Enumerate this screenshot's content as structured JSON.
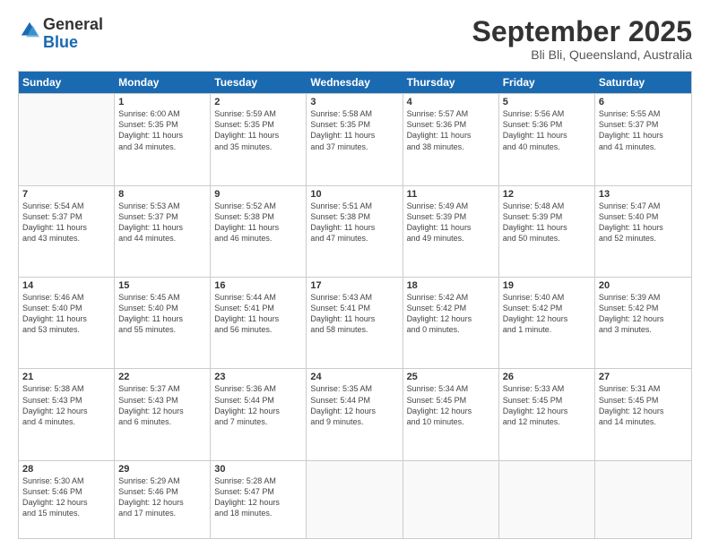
{
  "logo": {
    "general": "General",
    "blue": "Blue"
  },
  "title": "September 2025",
  "location": "Bli Bli, Queensland, Australia",
  "days": [
    "Sunday",
    "Monday",
    "Tuesday",
    "Wednesday",
    "Thursday",
    "Friday",
    "Saturday"
  ],
  "weeks": [
    [
      {
        "day": "",
        "content": ""
      },
      {
        "day": "1",
        "content": "Sunrise: 6:00 AM\nSunset: 5:35 PM\nDaylight: 11 hours\nand 34 minutes."
      },
      {
        "day": "2",
        "content": "Sunrise: 5:59 AM\nSunset: 5:35 PM\nDaylight: 11 hours\nand 35 minutes."
      },
      {
        "day": "3",
        "content": "Sunrise: 5:58 AM\nSunset: 5:35 PM\nDaylight: 11 hours\nand 37 minutes."
      },
      {
        "day": "4",
        "content": "Sunrise: 5:57 AM\nSunset: 5:36 PM\nDaylight: 11 hours\nand 38 minutes."
      },
      {
        "day": "5",
        "content": "Sunrise: 5:56 AM\nSunset: 5:36 PM\nDaylight: 11 hours\nand 40 minutes."
      },
      {
        "day": "6",
        "content": "Sunrise: 5:55 AM\nSunset: 5:37 PM\nDaylight: 11 hours\nand 41 minutes."
      }
    ],
    [
      {
        "day": "7",
        "content": "Sunrise: 5:54 AM\nSunset: 5:37 PM\nDaylight: 11 hours\nand 43 minutes."
      },
      {
        "day": "8",
        "content": "Sunrise: 5:53 AM\nSunset: 5:37 PM\nDaylight: 11 hours\nand 44 minutes."
      },
      {
        "day": "9",
        "content": "Sunrise: 5:52 AM\nSunset: 5:38 PM\nDaylight: 11 hours\nand 46 minutes."
      },
      {
        "day": "10",
        "content": "Sunrise: 5:51 AM\nSunset: 5:38 PM\nDaylight: 11 hours\nand 47 minutes."
      },
      {
        "day": "11",
        "content": "Sunrise: 5:49 AM\nSunset: 5:39 PM\nDaylight: 11 hours\nand 49 minutes."
      },
      {
        "day": "12",
        "content": "Sunrise: 5:48 AM\nSunset: 5:39 PM\nDaylight: 11 hours\nand 50 minutes."
      },
      {
        "day": "13",
        "content": "Sunrise: 5:47 AM\nSunset: 5:40 PM\nDaylight: 11 hours\nand 52 minutes."
      }
    ],
    [
      {
        "day": "14",
        "content": "Sunrise: 5:46 AM\nSunset: 5:40 PM\nDaylight: 11 hours\nand 53 minutes."
      },
      {
        "day": "15",
        "content": "Sunrise: 5:45 AM\nSunset: 5:40 PM\nDaylight: 11 hours\nand 55 minutes."
      },
      {
        "day": "16",
        "content": "Sunrise: 5:44 AM\nSunset: 5:41 PM\nDaylight: 11 hours\nand 56 minutes."
      },
      {
        "day": "17",
        "content": "Sunrise: 5:43 AM\nSunset: 5:41 PM\nDaylight: 11 hours\nand 58 minutes."
      },
      {
        "day": "18",
        "content": "Sunrise: 5:42 AM\nSunset: 5:42 PM\nDaylight: 12 hours\nand 0 minutes."
      },
      {
        "day": "19",
        "content": "Sunrise: 5:40 AM\nSunset: 5:42 PM\nDaylight: 12 hours\nand 1 minute."
      },
      {
        "day": "20",
        "content": "Sunrise: 5:39 AM\nSunset: 5:42 PM\nDaylight: 12 hours\nand 3 minutes."
      }
    ],
    [
      {
        "day": "21",
        "content": "Sunrise: 5:38 AM\nSunset: 5:43 PM\nDaylight: 12 hours\nand 4 minutes."
      },
      {
        "day": "22",
        "content": "Sunrise: 5:37 AM\nSunset: 5:43 PM\nDaylight: 12 hours\nand 6 minutes."
      },
      {
        "day": "23",
        "content": "Sunrise: 5:36 AM\nSunset: 5:44 PM\nDaylight: 12 hours\nand 7 minutes."
      },
      {
        "day": "24",
        "content": "Sunrise: 5:35 AM\nSunset: 5:44 PM\nDaylight: 12 hours\nand 9 minutes."
      },
      {
        "day": "25",
        "content": "Sunrise: 5:34 AM\nSunset: 5:45 PM\nDaylight: 12 hours\nand 10 minutes."
      },
      {
        "day": "26",
        "content": "Sunrise: 5:33 AM\nSunset: 5:45 PM\nDaylight: 12 hours\nand 12 minutes."
      },
      {
        "day": "27",
        "content": "Sunrise: 5:31 AM\nSunset: 5:45 PM\nDaylight: 12 hours\nand 14 minutes."
      }
    ],
    [
      {
        "day": "28",
        "content": "Sunrise: 5:30 AM\nSunset: 5:46 PM\nDaylight: 12 hours\nand 15 minutes."
      },
      {
        "day": "29",
        "content": "Sunrise: 5:29 AM\nSunset: 5:46 PM\nDaylight: 12 hours\nand 17 minutes."
      },
      {
        "day": "30",
        "content": "Sunrise: 5:28 AM\nSunset: 5:47 PM\nDaylight: 12 hours\nand 18 minutes."
      },
      {
        "day": "",
        "content": ""
      },
      {
        "day": "",
        "content": ""
      },
      {
        "day": "",
        "content": ""
      },
      {
        "day": "",
        "content": ""
      }
    ]
  ]
}
